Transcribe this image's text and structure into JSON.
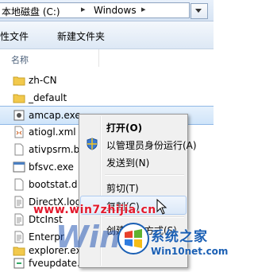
{
  "address": {
    "crumbs": [
      "本地磁盘 (C:)",
      "Windows"
    ]
  },
  "toolbar": {
    "items": [
      "性文件",
      "新建文件夹"
    ]
  },
  "columns": {
    "name": "名称"
  },
  "files": [
    {
      "name": "zh-CN",
      "icon": "folder-icon"
    },
    {
      "name": "_default",
      "icon": "folder-icon"
    },
    {
      "name": "amcap.exe",
      "icon": "application-icon"
    },
    {
      "name": "atiogl.xml",
      "icon": "xml-file-icon"
    },
    {
      "name": "ativpsrm.b",
      "icon": "file-icon"
    },
    {
      "name": "bfsvc.exe",
      "icon": "application-icon"
    },
    {
      "name": "bootstat.d",
      "icon": "file-icon"
    },
    {
      "name": "DirectX.log",
      "icon": "text-file-icon"
    },
    {
      "name": "DtcInst",
      "icon": "text-file-icon"
    },
    {
      "name": "Enterpr",
      "icon": "text-file-icon"
    },
    {
      "name": "explorer.exe",
      "icon": "folder-app-icon"
    },
    {
      "name": "fveupdate.",
      "icon": "application-icon"
    }
  ],
  "context_menu": {
    "items": [
      {
        "label": "打开(O)",
        "bold": true
      },
      {
        "label": "以管理员身份运行(A)",
        "icon": "shield-icon"
      },
      {
        "label": "发送到(N)"
      },
      {
        "label": "剪切(T)"
      },
      {
        "label": "复制(C)"
      },
      {
        "label": "创建快捷方式(S)"
      }
    ]
  },
  "watermark": {
    "url": "www.win7zhijia.cn",
    "brand": "系统之家",
    "site": "Win10net.com",
    "big": "Win"
  },
  "colors": {
    "accent": "#1a5fb4",
    "selection": "#cfe4f9",
    "watermark_red": "#e2182c"
  }
}
